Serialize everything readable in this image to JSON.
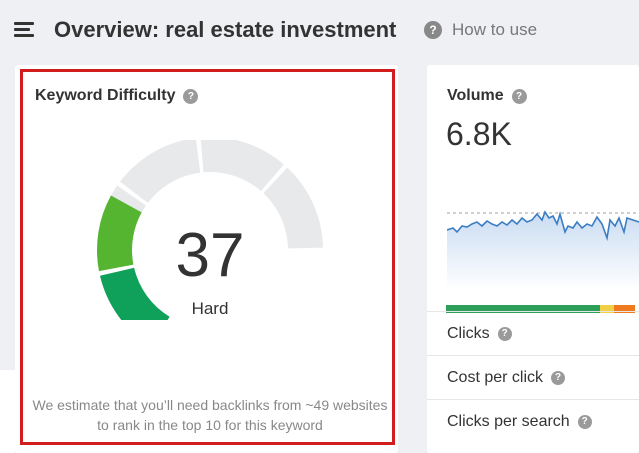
{
  "header": {
    "title": "Overview: real estate investment",
    "how_to_use": "How to use",
    "help_glyph": "?"
  },
  "keyword_difficulty": {
    "title": "Keyword Difficulty",
    "value": "37",
    "rating": "Hard",
    "estimate": "We estimate that you’ll need backlinks from ~49 websites to rank in the top 10 for this keyword",
    "score_fraction": 0.37
  },
  "volume": {
    "title": "Volume",
    "value": "6.8K",
    "split_segments": [
      {
        "fraction": 0.8,
        "color": "#2e9e5b"
      },
      {
        "fraction": 0.07,
        "color": "#f2d045"
      },
      {
        "fraction": 0.11,
        "color": "#f07a1e"
      },
      {
        "fraction": 0.02,
        "color": "#ffffff"
      }
    ]
  },
  "metrics": [
    {
      "label": "Clicks"
    },
    {
      "label": "Cost per click"
    },
    {
      "label": "Clicks per search"
    }
  ],
  "colors": {
    "accent_red": "#d11d1d",
    "gauge_track": "#e8e9eb",
    "gauge_green_dark": "#0fa15a",
    "gauge_green_mid": "#55b531",
    "gauge_yellow_green": "#a6c61e",
    "sparkline": "#3b7dc4"
  }
}
